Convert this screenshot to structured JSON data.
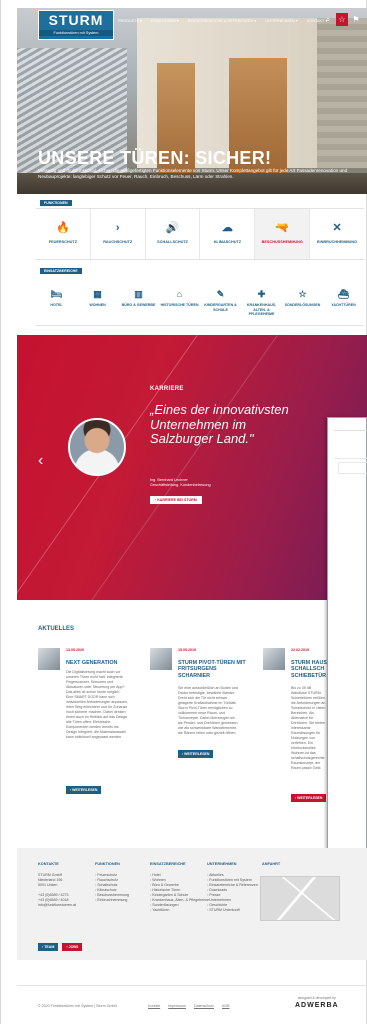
{
  "header": {
    "logo_mark": "STURM",
    "logo_tag": "Funktionstüren mit System",
    "nav": [
      "PRODUKTE ▾",
      "FUNKTIONEN ▾",
      "EINSATZBEREICHE & REFERENZEN ▾",
      "UNTERNEHMEN ▾",
      "KONTAKT ▾"
    ],
    "icons": [
      "search-icon",
      "star-icon",
      "flag-icon"
    ]
  },
  "hero": {
    "title": "UNSERE TÜREN: SICHER!",
    "subtitle": "Vielseitig und multifunktional, sicher: die maßgefertigten Funktionselemente von Sturm. Unser Komplettangebot gilt für jede Art Fassadenrenovation und Neubauprojekte: langlebiger Schutz vor Feuer, Rauch, Einbruch, Beschuss, Lärm oder Strahlen."
  },
  "functions": {
    "label": "FUNKTIONEN",
    "items": [
      {
        "label": "FEUERSCHUTZ",
        "icon": "🔥",
        "name": "fire-icon"
      },
      {
        "label": "RAUCHSCHUTZ",
        "icon": "›",
        "name": "smoke-icon"
      },
      {
        "label": "SCHALLSCHUTZ",
        "icon": "🔊",
        "name": "sound-icon"
      },
      {
        "label": "KLIMASCHUTZ",
        "icon": "☁",
        "name": "climate-icon"
      },
      {
        "label": "BESCHUSSHEMMUNG",
        "icon": "🔫",
        "name": "bullet-icon"
      },
      {
        "label": "EINBRUCHHEMMUNG",
        "icon": "✕",
        "name": "burglary-icon"
      }
    ]
  },
  "areas": {
    "label": "EINSATZBEREICHE",
    "items": [
      {
        "label": "HOTEL",
        "icon": "🛏",
        "name": "hotel-icon"
      },
      {
        "label": "WOHNEN",
        "icon": "▦",
        "name": "housing-icon"
      },
      {
        "label": "BÜRO & GEWERBE",
        "icon": "▥",
        "name": "office-icon"
      },
      {
        "label": "HISTORISCHE TÜREN",
        "icon": "⌂",
        "name": "historic-icon"
      },
      {
        "label": "KINDERGARTEN & SCHULE",
        "icon": "✎",
        "name": "school-icon"
      },
      {
        "label": "KRANKENHAUS, ALTEN- & PFLEGEHEIME",
        "icon": "✚",
        "name": "hospital-icon"
      },
      {
        "label": "SONDERLÖSUNGEN",
        "icon": "☆",
        "name": "special-icon"
      },
      {
        "label": "YACHTTÜREN",
        "icon": "⛴",
        "name": "yacht-icon"
      }
    ]
  },
  "career": {
    "label": "KARRIERE",
    "quote": "„Eines der innovativsten Unternehmen im Salzburger Land.\"",
    "author": "Ing. Bernhard Lechner\nGeschäftsleitung, Kundenbetreuung",
    "button": "› KARRIERE BEI STURM"
  },
  "news": {
    "title": "AKTUELLES",
    "cards": [
      {
        "date": "13.05.2020",
        "head": "NEXT GENERATION",
        "body": "Die Digitalisierung macht auch vor unseren Türen nicht halt. Integrierte Fingerscanner, Sensoren und Aktuatoren oder Steuerung per App? Das alles ist schon heute möglich. Eine SMART DOOR kann sich individuellen Anforderungen anpassen, ihren Weg erleichtern und Ihr Zuhause noch sicherer machen. Dabei denken Ihnen auch im Hinblick auf das Design alle Türen offen: Elektrische Komponenten werden bereits ins Design integriert, die Materialauswahl kann individuell angepasst werden.",
        "button": "› WEITERLESEN"
      },
      {
        "date": "15.05.2019",
        "head": "STURM PIVOT-TÜREN MIT FRITSURGENS SCHARNIER",
        "body": "Sie eine ausschließlich an Boden und Decke befestigte, bewährte Bänder. Dreht sich die Tür nicht schwer gelagerte Kraftaufnahme im Türblatt. Sturm Pivot-Türen ermöglichen so vollkommen neue Raum- und Türkonzepte. Dabei überzeugen sie als Pendel- und Drehtüren gemessen wie als schwenkbare Wandelemente, die Räume teilen oder gezielt öffnen.",
        "button": "› WEITERLESEN"
      },
      {
        "date": "22.02.2019",
        "head": "STURM HAUS: SCHALLSCH SCHIEBETÜR",
        "body": "Bis zu 39 dB Wandlose STURM-Schiebetüren erfüllen die Anforderungen an Schallschutz in vielen Bereichen. Als Alternative für Drehtüren. Sie bieten interessante Raumlösungen für Nutzungen von verfehlen. Ein eindrucksvolles Wohnen ist das schallschutzgerechte Raumkonzept, der Raum passiv Geld.",
        "button": "› WEITERLESEN"
      }
    ]
  },
  "footer": {
    "contact": {
      "head": "KONTAKTE",
      "lines": [
        "STURM GmbH",
        "Niederland 196",
        "5091 Unken",
        "",
        "+43 (0)6589 / 4273",
        "+43 (0)6589 / 4018",
        "info@funktionstueren.at"
      ]
    },
    "functions": {
      "head": "FUNKTIONEN",
      "lines": [
        "Feuerschutz",
        "Rauchschutz",
        "Schallschutz",
        "Klimaschutz",
        "Beschusshemmung",
        "Einbruchhemmung"
      ]
    },
    "areas": {
      "head": "EINSATZBEREICHE",
      "lines": [
        "Hotel",
        "Wohnen",
        "Büro & Gewerbe",
        "Historische Türen",
        "Kindergarten & Schule",
        "Krankenhaus, Alten- & Pflegeheime",
        "Sonderlösungen",
        "Yachttüren"
      ]
    },
    "company": {
      "head": "UNTERNEHMEN",
      "lines": [
        "Aktuelles",
        "Funktionstüren mit System",
        "Einsatzbereiche & Referenzen",
        "Downloads",
        "Presse",
        "Unternehmen",
        "Geschichte",
        "STURM Unterkunft"
      ]
    },
    "route": {
      "head": "ANFAHRT"
    },
    "buttons": [
      "› TEAM",
      "› JOBS"
    ],
    "copyright": "© 2020 Funktionstüren mit System | Sturm GmbH",
    "links": [
      "Kontakt",
      "Impressum",
      "Datenschutz",
      "AGB"
    ],
    "design_note": "designed & developed by",
    "design_brand": "ADWERBA"
  }
}
